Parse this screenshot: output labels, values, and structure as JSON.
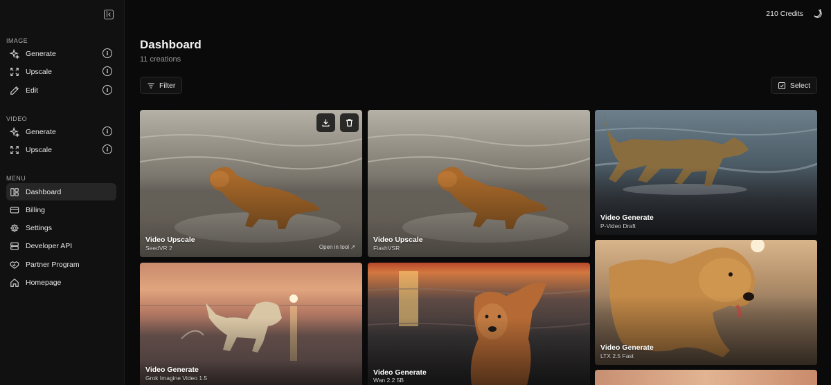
{
  "sidebar": {
    "sections": [
      {
        "label": "IMAGE",
        "items": [
          {
            "label": "Generate",
            "icon": "sparkle-icon"
          },
          {
            "label": "Upscale",
            "icon": "expand-icon"
          },
          {
            "label": "Edit",
            "icon": "pencil-icon"
          }
        ]
      },
      {
        "label": "VIDEO",
        "items": [
          {
            "label": "Generate",
            "icon": "sparkle-icon"
          },
          {
            "label": "Upscale",
            "icon": "expand-icon"
          }
        ]
      },
      {
        "label": "MENU",
        "items": [
          {
            "label": "Dashboard",
            "icon": "dashboard-icon",
            "active": true
          },
          {
            "label": "Billing",
            "icon": "credit-card-icon"
          },
          {
            "label": "Settings",
            "icon": "gear-icon"
          },
          {
            "label": "Developer API",
            "icon": "server-icon"
          },
          {
            "label": "Partner Program",
            "icon": "handshake-icon"
          },
          {
            "label": "Homepage",
            "icon": "home-icon"
          }
        ]
      }
    ]
  },
  "topbar": {
    "credits": "210 Credits"
  },
  "main": {
    "title": "Dashboard",
    "subtitle": "11 creations",
    "filter_label": "Filter",
    "select_label": "Select"
  },
  "cards": [
    {
      "title": "Video Upscale",
      "model": "SeedVR 2",
      "open_label": "Open in tool ↗"
    },
    {
      "title": "Video Upscale",
      "model": "FlashVSR"
    },
    {
      "title": "Video Generate",
      "model": "P-Video Draft"
    },
    {
      "title": "Video Generate",
      "model": "Grok Imagine Video 1.5"
    },
    {
      "title": "Video Generate",
      "model": "Wan 2.2 5B"
    },
    {
      "title": "Video Generate",
      "model": "LTX 2.5 Fast"
    }
  ],
  "colors": {
    "background": "#0a0a0a",
    "sidebar": "#111111",
    "active_item": "#262626",
    "accent_text": "#e6e6e6"
  }
}
